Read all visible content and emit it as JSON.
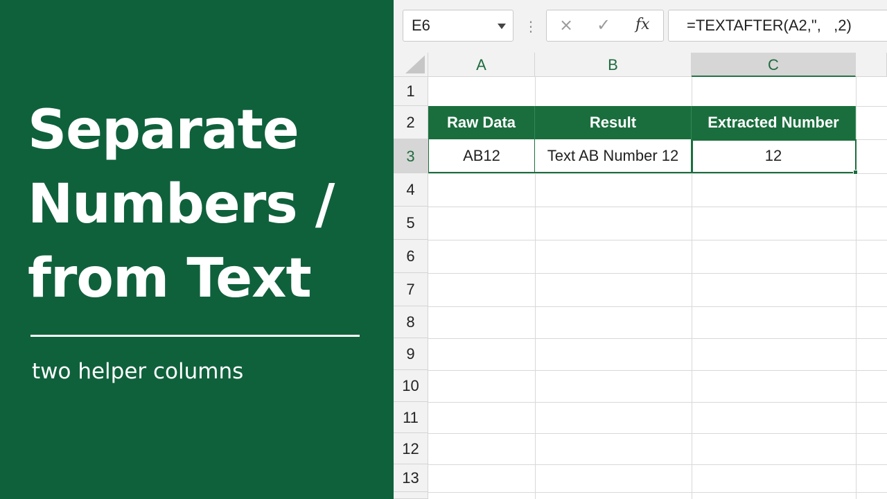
{
  "title": {
    "lines": [
      "Separate",
      "Numbers /",
      "from Text"
    ],
    "subtitle": "two helper columns"
  },
  "formula_bar": {
    "name_box": "E6",
    "cancel_icon": "×",
    "confirm_icon": "✓",
    "function_label": "fx",
    "formula": "=TEXTAFTER(A2,\",   ,2)"
  },
  "columns": [
    "A",
    "B",
    "C"
  ],
  "selected_column": "C",
  "rows": [
    "1",
    "2",
    "3",
    "4",
    "5",
    "6",
    "7",
    "8",
    "9",
    "10",
    "11",
    "12",
    "13"
  ],
  "selected_row": "3",
  "table": {
    "headers": [
      "Raw Data",
      "Result",
      "Extracted Number"
    ],
    "row": [
      "AB12",
      "Text AB Number 12",
      "12"
    ]
  },
  "colors": {
    "panel_green": "#0f613b",
    "header_green": "#1a6e3d"
  }
}
